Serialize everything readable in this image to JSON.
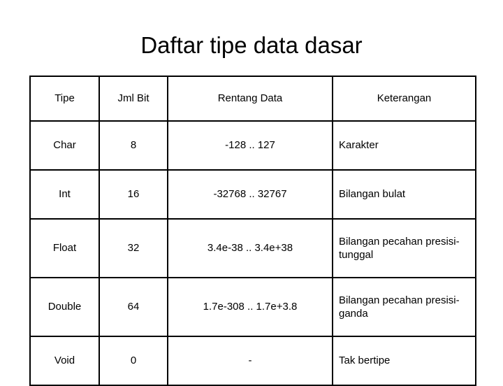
{
  "slide": {
    "title": "Daftar tipe data dasar"
  },
  "table": {
    "headers": [
      "Tipe",
      "Jml Bit",
      "Rentang Data",
      "Keterangan"
    ],
    "rows": [
      {
        "tipe": "Char",
        "bit": "8",
        "rentang": "-128 .. 127",
        "keterangan": "Karakter"
      },
      {
        "tipe": "Int",
        "bit": "16",
        "rentang": "-32768 .. 32767",
        "keterangan": "Bilangan bulat"
      },
      {
        "tipe": "Float",
        "bit": "32",
        "rentang": "3.4e-38 .. 3.4e+38",
        "keterangan": "Bilangan pecahan presisi-tunggal"
      },
      {
        "tipe": "Double",
        "bit": "64",
        "rentang": "1.7e-308 .. 1.7e+3.8",
        "keterangan": "Bilangan pecahan presisi-ganda"
      },
      {
        "tipe": "Void",
        "bit": "0",
        "rentang": "-",
        "keterangan": "Tak bertipe"
      }
    ]
  }
}
